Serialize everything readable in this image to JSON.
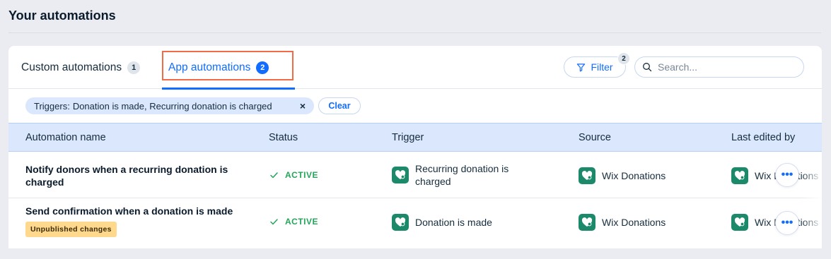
{
  "page": {
    "title": "Your automations"
  },
  "tabs": [
    {
      "label": "Custom automations",
      "count": "1"
    },
    {
      "label": "App automations",
      "count": "2"
    }
  ],
  "toolbar": {
    "filter_label": "Filter",
    "filter_count": "2",
    "search_placeholder": "Search..."
  },
  "filters": {
    "chip_key": "Triggers:",
    "chip_value": "Donation is made, Recurring donation is charged",
    "clear_label": "Clear"
  },
  "table": {
    "columns": [
      "Automation name",
      "Status",
      "Trigger",
      "Source",
      "Last edited by"
    ],
    "rows": [
      {
        "name": "Notify donors when a recurring donation is charged",
        "status": "ACTIVE",
        "trigger": "Recurring donation is charged",
        "source": "Wix Donations",
        "edited_by": "Wix Donations",
        "badge": ""
      },
      {
        "name": "Send confirmation when a donation is made",
        "status": "ACTIVE",
        "trigger": "Donation is made",
        "source": "Wix Donations",
        "edited_by": "Wix Donations",
        "badge": "Unpublished changes"
      }
    ]
  },
  "icons": {
    "filter": "filter-icon",
    "search": "search-icon",
    "status": "check-icon",
    "app": "wix-donations-heart-icon",
    "more": "more-actions-icon"
  },
  "colors": {
    "accent": "#116dff",
    "active": "#25a55a",
    "highlight": "#f26b47",
    "app_icon": "#1c8a6a",
    "unpublished": "#fdd88d"
  }
}
